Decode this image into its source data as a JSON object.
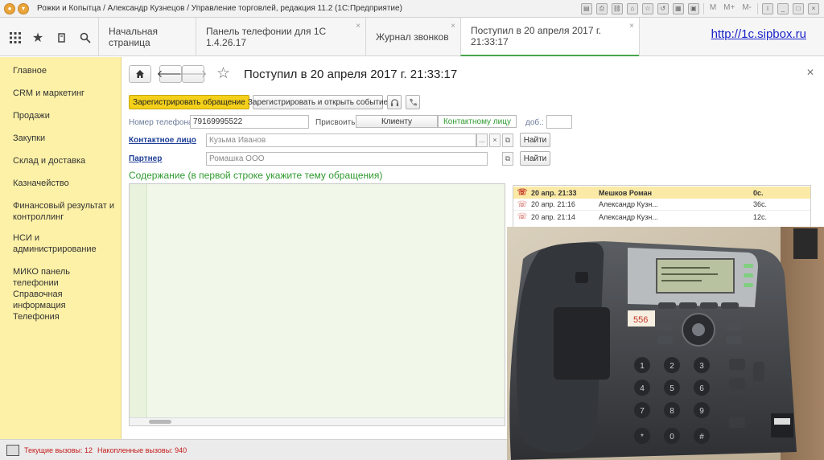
{
  "window": {
    "title": "Рожки и Копытца / Александр Кузнецов / Управление торговлей, редакция 11.2  (1С:Предприятие)",
    "tool_m": "M",
    "tool_mplus": "M+",
    "tool_mminus": "M-"
  },
  "tabs": [
    {
      "label": "Начальная страница"
    },
    {
      "label": "Панель телефонии для 1С 1.4.26.17"
    },
    {
      "label": "Журнал звонков"
    },
    {
      "label": "Поступил в 20 апреля 2017 г. 21:33:17"
    }
  ],
  "site_link": "http://1c.sipbox.ru",
  "sidebar": {
    "items": [
      {
        "label": "Главное"
      },
      {
        "label": "CRM и маркетинг"
      },
      {
        "label": "Продажи"
      },
      {
        "label": "Закупки"
      },
      {
        "label": "Склад и доставка"
      },
      {
        "label": "Казначейство"
      },
      {
        "label": "Финансовый результат и контроллинг"
      },
      {
        "label": "НСИ и администрирование"
      },
      {
        "label": "МИКО панель телефонии"
      },
      {
        "label": "Справочная информация"
      },
      {
        "label": "Телефония"
      }
    ]
  },
  "form": {
    "title": "Поступил в 20 апреля 2017 г. 21:33:17",
    "register_button": "Зарегистрировать обращение",
    "register_open_button": "Зарегистрировать и открыть событие",
    "phone_label": "Номер телефона:",
    "phone_value": "79169995522",
    "assign_label": "Присвоить:",
    "assign_client": "Клиенту",
    "assign_contact": "Контактному лицу",
    "ext_label": "доб.:",
    "contact_label": "Контактное лицо",
    "contact_value": "Кузьма Иванов",
    "partner_label": "Партнер",
    "partner_value": "Ромашка ООО",
    "find_button": "Найти",
    "ellipsis": "...",
    "clear": "×",
    "content_title": "Содержание (в первой строке укажите тему обращения)"
  },
  "calls": [
    {
      "time": "20 апр. 21:33",
      "name": "Мешков Роман",
      "duration": "0с."
    },
    {
      "time": "20 апр. 21:16",
      "name": "Александр Кузн...",
      "duration": "36с."
    },
    {
      "time": "20 апр. 21:14",
      "name": "Александр Кузн...",
      "duration": "12с."
    }
  ],
  "status": {
    "current_calls": "Текущие вызовы: 12",
    "accumulated_calls": "Накопленные вызовы: 940"
  },
  "photo": {
    "sticker": "556"
  },
  "colors": {
    "sidebar_bg": "#fdf1a7",
    "primary_button": "#f4d01a",
    "link": "#1a23c9",
    "section_green": "#2f9a2f",
    "status_red": "#c51a1a"
  }
}
